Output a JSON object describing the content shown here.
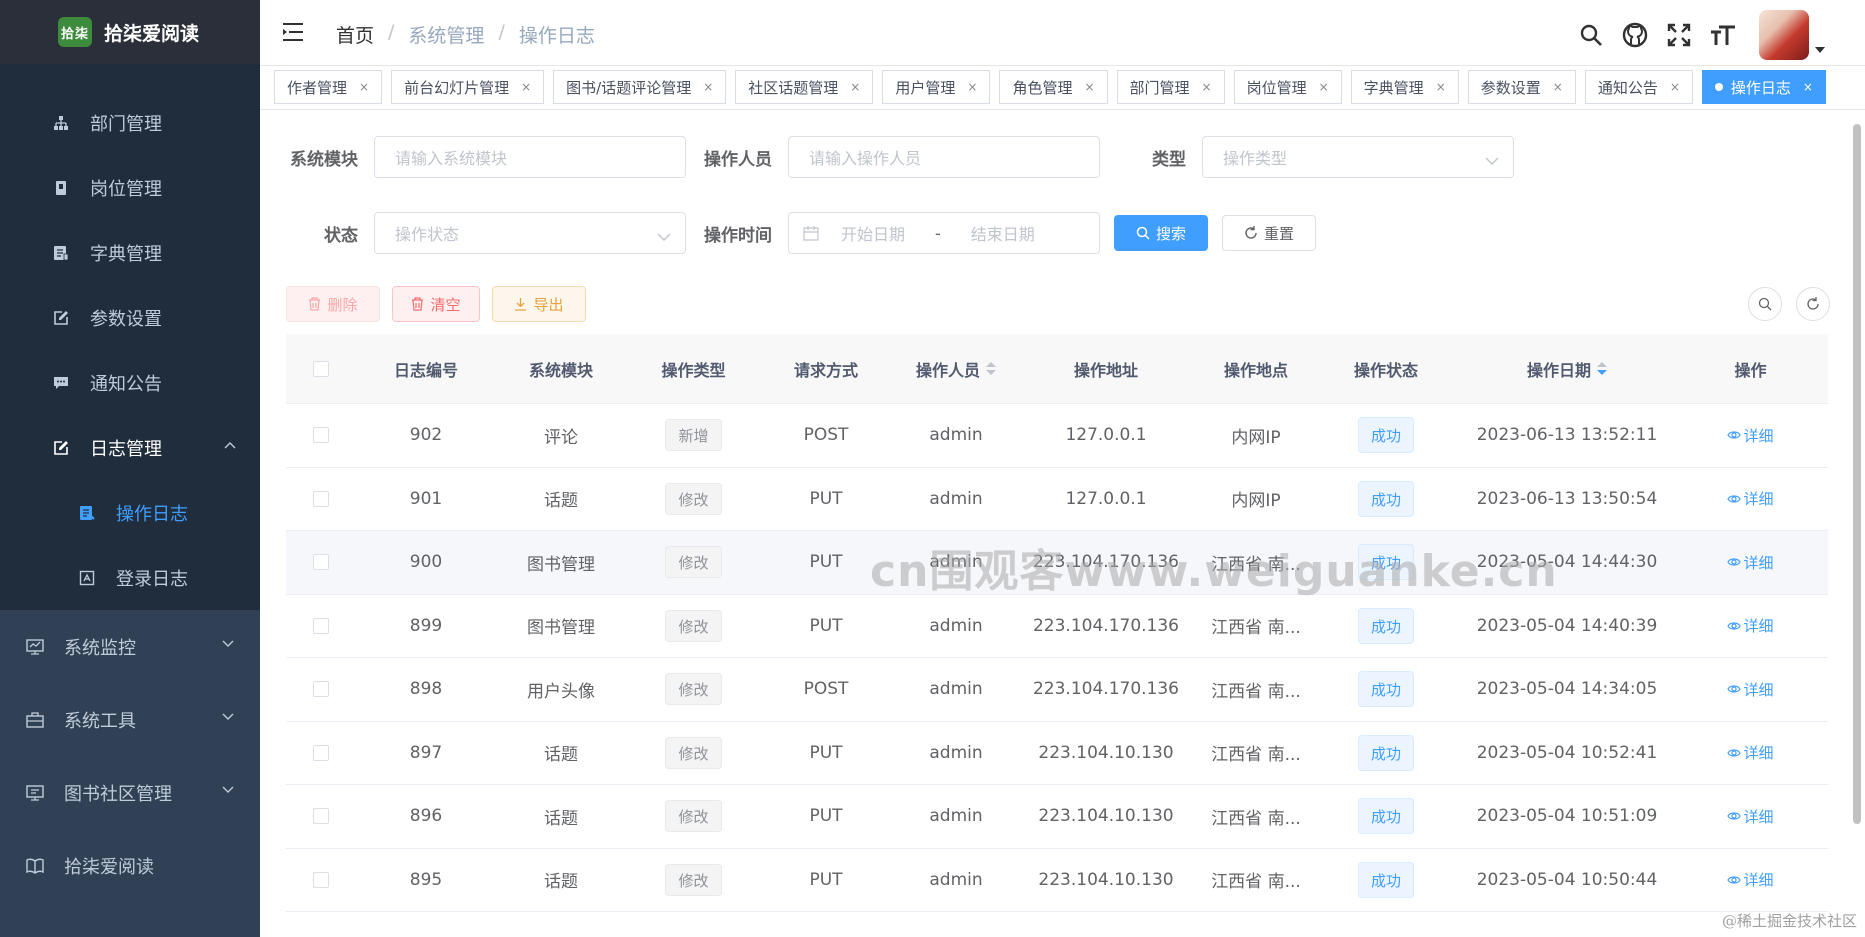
{
  "brand": {
    "logo_text": "拾柒",
    "title": "拾柒爱阅读"
  },
  "sidebar": {
    "sub_items": [
      {
        "label": "部门管理",
        "icon": "tree-icon"
      },
      {
        "label": "岗位管理",
        "icon": "post-icon"
      },
      {
        "label": "字典管理",
        "icon": "dict-icon"
      },
      {
        "label": "参数设置",
        "icon": "edit-icon"
      },
      {
        "label": "通知公告",
        "icon": "message-icon"
      },
      {
        "label": "日志管理",
        "icon": "log-icon"
      }
    ],
    "log_children": [
      {
        "label": "操作日志",
        "icon": "form-icon"
      },
      {
        "label": "登录日志",
        "icon": "logininfor-icon"
      }
    ],
    "top_items": [
      {
        "label": "系统监控",
        "icon": "monitor-icon"
      },
      {
        "label": "系统工具",
        "icon": "tool-icon"
      },
      {
        "label": "图书社区管理",
        "icon": "book-icon"
      },
      {
        "label": "拾柒爱阅读",
        "icon": "reading-icon"
      }
    ]
  },
  "navbar": {
    "breadcrumb": [
      "首页",
      "系统管理",
      "操作日志"
    ]
  },
  "tags": [
    "作者管理",
    "前台幻灯片管理",
    "图书/话题评论管理",
    "社区话题管理",
    "用户管理",
    "角色管理",
    "部门管理",
    "岗位管理",
    "字典管理",
    "参数设置",
    "通知公告",
    "操作日志"
  ],
  "filters": {
    "module_label": "系统模块",
    "module_placeholder": "请输入系统模块",
    "operator_label": "操作人员",
    "operator_placeholder": "请输入操作人员",
    "type_label": "类型",
    "type_placeholder": "操作类型",
    "status_label": "状态",
    "status_placeholder": "操作状态",
    "time_label": "操作时间",
    "start_placeholder": "开始日期",
    "date_sep": "-",
    "end_placeholder": "结束日期",
    "search_label": "搜索",
    "reset_label": "重置"
  },
  "toolbar": {
    "delete_label": "删除",
    "clear_label": "清空",
    "export_label": "导出"
  },
  "table": {
    "columns": [
      "日志编号",
      "系统模块",
      "操作类型",
      "请求方式",
      "操作人员",
      "操作地址",
      "操作地点",
      "操作状态",
      "操作日期",
      "操作"
    ],
    "rows": [
      [
        "902",
        "评论",
        "新增",
        "POST",
        "admin",
        "127.0.0.1",
        "内网IP",
        "成功",
        "2023-06-13 13:52:11",
        "详细"
      ],
      [
        "901",
        "话题",
        "修改",
        "PUT",
        "admin",
        "127.0.0.1",
        "内网IP",
        "成功",
        "2023-06-13 13:50:54",
        "详细"
      ],
      [
        "900",
        "图书管理",
        "修改",
        "PUT",
        "admin",
        "223.104.170.136",
        "江西省 南...",
        "成功",
        "2023-05-04 14:44:30",
        "详细"
      ],
      [
        "899",
        "图书管理",
        "修改",
        "PUT",
        "admin",
        "223.104.170.136",
        "江西省 南...",
        "成功",
        "2023-05-04 14:40:39",
        "详细"
      ],
      [
        "898",
        "用户头像",
        "修改",
        "POST",
        "admin",
        "223.104.170.136",
        "江西省 南...",
        "成功",
        "2023-05-04 14:34:05",
        "详细"
      ],
      [
        "897",
        "话题",
        "修改",
        "PUT",
        "admin",
        "223.104.10.130",
        "江西省 南...",
        "成功",
        "2023-05-04 10:52:41",
        "详细"
      ],
      [
        "896",
        "话题",
        "修改",
        "PUT",
        "admin",
        "223.104.10.130",
        "江西省 南...",
        "成功",
        "2023-05-04 10:51:09",
        "详细"
      ],
      [
        "895",
        "话题",
        "修改",
        "PUT",
        "admin",
        "223.104.10.130",
        "江西省 南...",
        "成功",
        "2023-05-04 10:50:44",
        "详细"
      ]
    ]
  },
  "watermark": "cn围观客www.weiguanke.cn",
  "corner_mark": "@稀土掘金技术社区",
  "colors": {
    "sidebar_bg": "#304156",
    "primary": "#409eff",
    "danger": "#f56c6c",
    "warning": "#e6a23c"
  }
}
